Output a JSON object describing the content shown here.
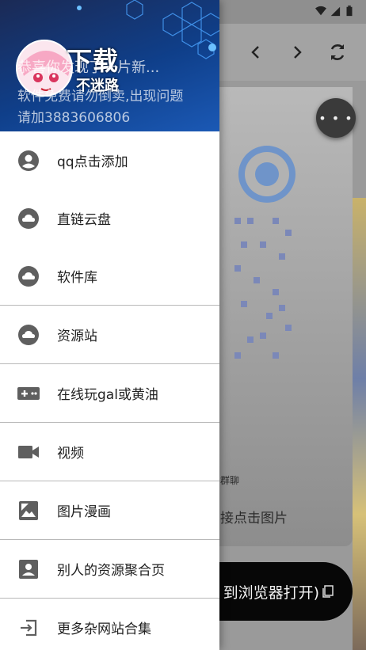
{
  "status_bar": {
    "left_text": "",
    "icons": [
      "wifi-icon",
      "signal-icon",
      "battery-icon"
    ]
  },
  "toolbar": {
    "icons": [
      "back-icon",
      "forward-icon",
      "refresh-icon"
    ]
  },
  "background": {
    "group_chat_text": "群聊",
    "tap_image_text": "接点击图片",
    "open_browser_text": "到浏览器打开)",
    "more_icon": "more-dots-icon"
  },
  "drawer": {
    "header": {
      "logo_text": "下载",
      "logo_sub": "不迷路",
      "line1": "恭喜你发现了一片新...",
      "line2": "软件免费请勿倒卖,出现问题",
      "line3": "请加3883606806"
    },
    "items": [
      {
        "label": "qq点击添加",
        "icon": "account-circle-icon"
      },
      {
        "label": "直链云盘",
        "icon": "cloud-icon"
      },
      {
        "label": "软件库",
        "icon": "cloud-icon"
      },
      {
        "label": "资源站",
        "icon": "cloud-icon"
      },
      {
        "label": "在线玩gal或黄油",
        "icon": "gamepad-icon"
      },
      {
        "label": "视频",
        "icon": "videocam-icon"
      },
      {
        "label": "图片漫画",
        "icon": "image-icon"
      },
      {
        "label": "别人的资源聚合页",
        "icon": "contact-card-icon"
      },
      {
        "label": "更多杂网站合集",
        "icon": "exit-arrow-icon"
      }
    ]
  },
  "colors": {
    "header_start": "#1b2a55",
    "header_end": "#1b59b5",
    "icon_gray": "#5f5f5f",
    "text": "#212121"
  }
}
